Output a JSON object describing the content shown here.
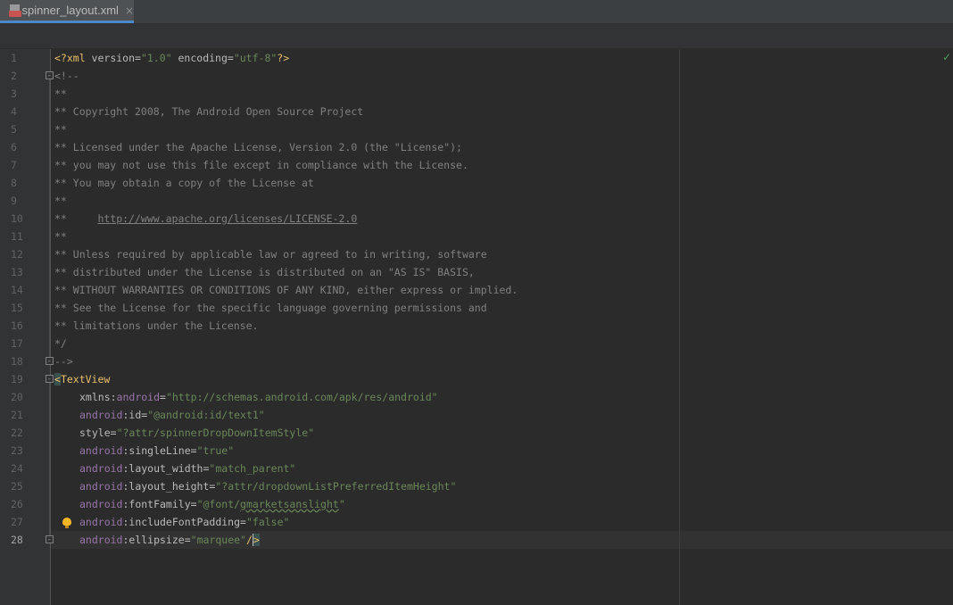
{
  "tab": {
    "title": "spinner_layout.xml",
    "close": "×"
  },
  "status": {
    "inspection": "✓"
  },
  "lines": [
    "1",
    "2",
    "3",
    "4",
    "5",
    "6",
    "7",
    "8",
    "9",
    "10",
    "11",
    "12",
    "13",
    "14",
    "15",
    "16",
    "17",
    "18",
    "19",
    "20",
    "21",
    "22",
    "23",
    "24",
    "25",
    "26",
    "27",
    "28"
  ],
  "code": {
    "l1": {
      "pi_open": "<?xml ",
      "a1": "version",
      "eq1": "=",
      "v1": "\"1.0\"",
      "a2": " encoding",
      "eq2": "=",
      "v2": "\"utf-8\"",
      "pi_close": "?>"
    },
    "l2": "<!--",
    "l3": "**",
    "l4": "** Copyright 2008, The Android Open Source Project",
    "l5": "**",
    "l6": "** Licensed under the Apache License, Version 2.0 (the \"License\");",
    "l7": "** you may not use this file except in compliance with the License.",
    "l8": "** You may obtain a copy of the License at",
    "l9": "**",
    "l10": {
      "prefix": "**     ",
      "url": "http://www.apache.org/licenses/LICENSE-2.0"
    },
    "l11": "**",
    "l12": "** Unless required by applicable law or agreed to in writing, software",
    "l13": "** distributed under the License is distributed on an \"AS IS\" BASIS,",
    "l14": "** WITHOUT WARRANTIES OR CONDITIONS OF ANY KIND, either express or implied.",
    "l15": "** See the License for the specific language governing permissions and",
    "l16": "** limitations under the License.",
    "l17": "*/",
    "l18": "-->",
    "l19": {
      "bracket": "<",
      "tag": "TextView"
    },
    "l20": {
      "a": "xmlns:",
      "ns": "android",
      "eq": "=",
      "v": "\"http://schemas.android.com/apk/res/android\""
    },
    "l21": {
      "ns": "android",
      "a": ":id",
      "eq": "=",
      "v": "\"@android:id/text1\""
    },
    "l22": {
      "a": "style",
      "eq": "=",
      "v": "\"?attr/spinnerDropDownItemStyle\""
    },
    "l23": {
      "ns": "android",
      "a": ":singleLine",
      "eq": "=",
      "v": "\"true\""
    },
    "l24": {
      "ns": "android",
      "a": ":layout_width",
      "eq": "=",
      "v": "\"match_parent\""
    },
    "l25": {
      "ns": "android",
      "a": ":layout_height",
      "eq": "=",
      "v": "\"?attr/dropdownListPreferredItemHeight\""
    },
    "l26": {
      "ns": "android",
      "a": ":fontFamily",
      "eq": "=",
      "v_pre": "\"@font/",
      "v_sq": "gmarketsanslight",
      "v_post": "\""
    },
    "l27": {
      "ns": "android",
      "a": ":includeFontPadding",
      "eq": "=",
      "v": "\"false\""
    },
    "l28": {
      "ns": "android",
      "a": ":ellipsize",
      "eq": "=",
      "v": "\"marquee\"",
      "close_a": "/",
      "close_b": ">"
    }
  }
}
